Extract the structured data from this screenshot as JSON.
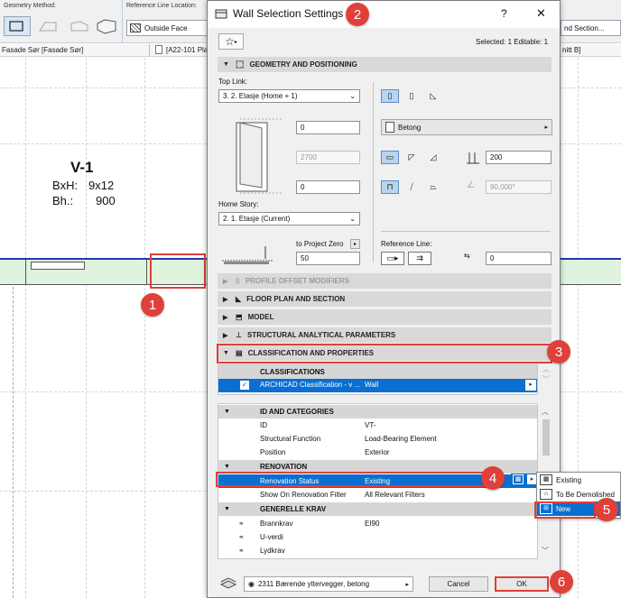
{
  "app": {
    "geometry_method_label": "Geometry Method:",
    "reference_line_location_label": "Reference Line Location:",
    "reference_line_value": "Outside Face",
    "tab_left": "Fasade Sør [Fasade Sør]",
    "tab_mid": "[A22-101 Pla",
    "tab_section": "nd Section...",
    "tab_right": "nitt B]",
    "label_title": "V-1",
    "label_bxh_key": "BxH:",
    "label_bxh_val": "9x12",
    "label_bh_key": "Bh.:",
    "label_bh_val": "900"
  },
  "dialog": {
    "title": "Wall Selection Settings",
    "help": "?",
    "close": "✕",
    "selected_info": "Selected: 1 Editable: 1",
    "geometry": {
      "header": "GEOMETRY AND POSITIONING",
      "top_link_label": "Top Link:",
      "top_link_value": "3. 2. Etasje (Home + 1)",
      "top_offset": "0",
      "height": "2700",
      "bottom_offset": "0",
      "home_story_label": "Home Story:",
      "home_story_value": "2. 1. Etasje (Current)",
      "to_project_zero_label": "to Project Zero",
      "to_project_zero_value": "50",
      "material": "Betong",
      "thickness": "200",
      "angle": "90,000°",
      "reference_line_label": "Reference Line:",
      "ref_offset": "0"
    },
    "sections": {
      "profile": "PROFILE OFFSET MODIFIERS",
      "floor_plan": "FLOOR PLAN AND SECTION",
      "model": "MODEL",
      "structural": "STRUCTURAL ANALYTICAL PARAMETERS",
      "classification": "CLASSIFICATION AND PROPERTIES"
    },
    "classifications": {
      "header": "CLASSIFICATIONS",
      "row_name": "ARCHICAD Classification - v ...",
      "row_value": "Wall"
    },
    "properties": {
      "id_header": "ID AND CATEGORIES",
      "rows": [
        {
          "name": "ID",
          "value": "VT-"
        },
        {
          "name": "Structural Function",
          "value": "Load-Bearing Element"
        },
        {
          "name": "Position",
          "value": "Exterior"
        }
      ],
      "renovation_header": "RENOVATION",
      "renovation_status_name": "Renovation Status",
      "renovation_status_value": "Existing",
      "renovation_filter_name": "Show On Renovation Filter",
      "renovation_filter_value": "All Relevant Filters",
      "general_header": "GENERELLE KRAV",
      "general_rows": [
        {
          "name": "Brannkrav",
          "value": "EI90"
        },
        {
          "name": "U-verdi",
          "value": ""
        },
        {
          "name": "Lydkrav",
          "value": ""
        }
      ]
    },
    "footer": {
      "favorite": "2311 Bærende yttervegger, betong",
      "cancel": "Cancel",
      "ok": "OK"
    }
  },
  "renovation_menu": {
    "items": [
      "Existing",
      "To Be Demolished",
      "New"
    ],
    "selected": "New"
  },
  "annotations": [
    "1",
    "2",
    "3",
    "4",
    "5",
    "6"
  ],
  "colors": {
    "annotation_red": "#e0403a",
    "selection_blue": "#0a6fd0",
    "wall_green": "#dff3df",
    "wall_outline_blue": "#1f3ea8"
  }
}
